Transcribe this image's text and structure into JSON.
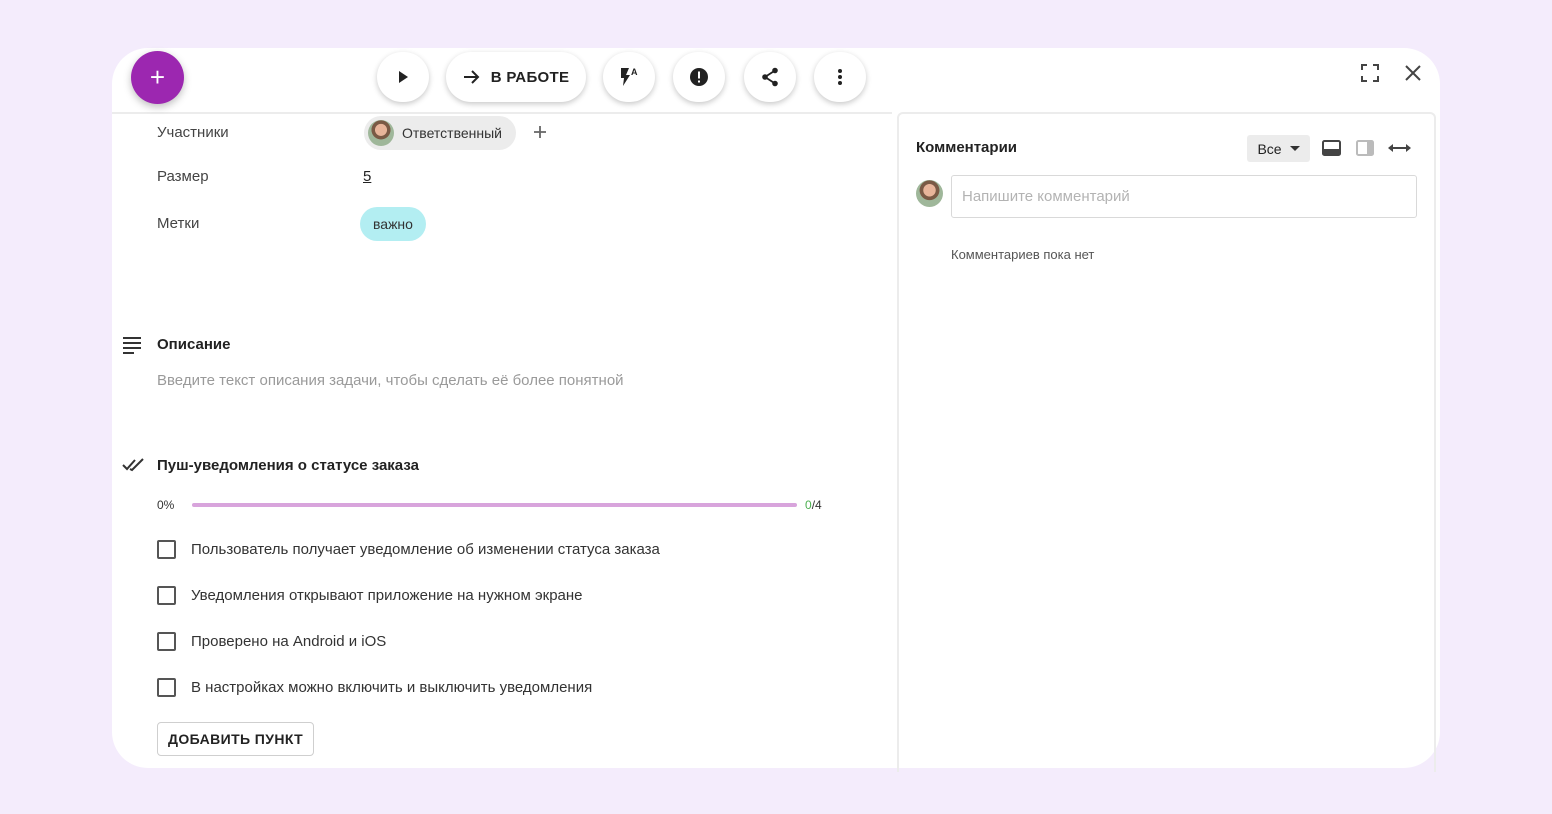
{
  "toolbar": {
    "add_label": "+",
    "status_label": "В РАБОТЕ",
    "icons": [
      "plus-icon",
      "play-icon",
      "arrow-right-icon",
      "flash-auto-icon",
      "alert-icon",
      "share-icon",
      "more-vert-icon",
      "fullscreen-icon",
      "close-icon"
    ]
  },
  "fields": {
    "participants_label": "Участники",
    "responsible_chip": "Ответственный",
    "size_label": "Размер",
    "size_value": "5",
    "tags_label": "Метки",
    "tag_value": "важно"
  },
  "description": {
    "title": "Описание",
    "placeholder": "Введите текст описания задачи, чтобы сделать её более понятной"
  },
  "checklist": {
    "title": "Пуш-уведомления о статусе заказа",
    "percent": "0%",
    "progress_fraction": 0,
    "done_count": "0",
    "total_count": "/4",
    "items": [
      "Пользователь получает уведомление об изменении статуса заказа",
      "Уведомления открывают приложение на нужном экране",
      "Проверено на Android и iOS",
      "В настройках можно включить и выключить уведомления"
    ],
    "add_button": "ДОБАВИТЬ ПУНКТ"
  },
  "comments": {
    "title": "Комментарии",
    "filter_value": "Все",
    "input_placeholder": "Напишите комментарий",
    "empty_text": "Комментариев пока нет"
  },
  "colors": {
    "accent": "#9c27b0",
    "tag_bg": "#b3eef2",
    "progress_track": "#d8a4dc",
    "page_bg": "#f4ecfc"
  }
}
